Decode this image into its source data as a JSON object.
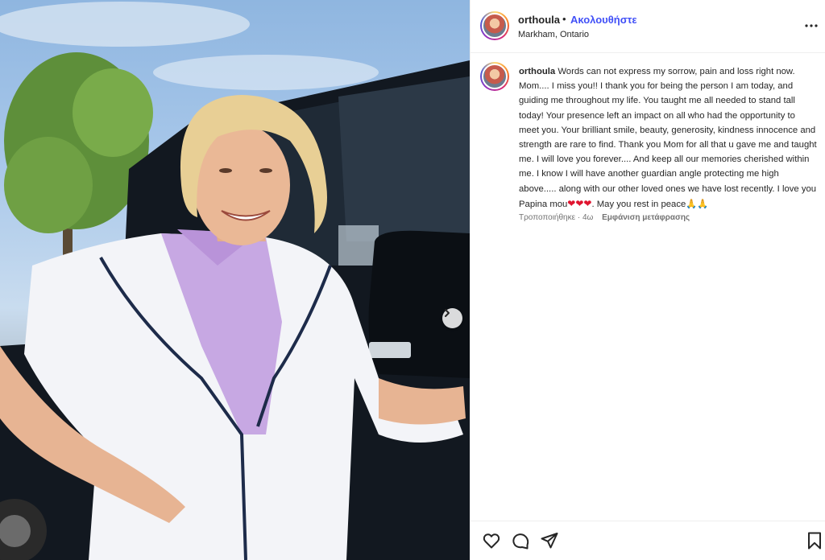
{
  "post": {
    "username": "orthoula",
    "separator": "•",
    "follow_label": "Ακολουθήστε",
    "location": "Markham, Ontario",
    "caption_username": "orthoula",
    "caption_text_main": "Words can not express my sorrow, pain and loss right now. Mom.... I miss you!! I thank you for being the person I am today, and guiding me throughout my life. You taught me all needed to stand tall today! Your presence left an impact on all who had the opportunity to meet you. Your brilliant smile, beauty, generosity, kindness innocence and strength are rare to find. Thank you Mom for all that u gave me and taught me. I will love you forever.... And keep all our memories cherished within me. I know I will have another guardian angle protecting me high above..... along with our other loved ones we have lost recently. I love you Papina mou",
    "caption_hearts": "❤❤❤",
    "caption_text_end": ". May you rest in peace",
    "caption_emoji_end": "🙏🙏",
    "edited_label": "Τροποποιήθηκε",
    "meta_dot": "·",
    "age": "4ω",
    "translate_label": "Εμφάνιση μετάφρασης"
  },
  "icons": {
    "like": "heart-icon",
    "comment": "comment-icon",
    "share": "send-icon",
    "save": "bookmark-icon",
    "more": "more-icon",
    "next": "chevron-right-icon"
  },
  "colors": {
    "follow": "#4150f7",
    "heart": "#e0142f",
    "text": "#262626",
    "muted": "#737373"
  }
}
